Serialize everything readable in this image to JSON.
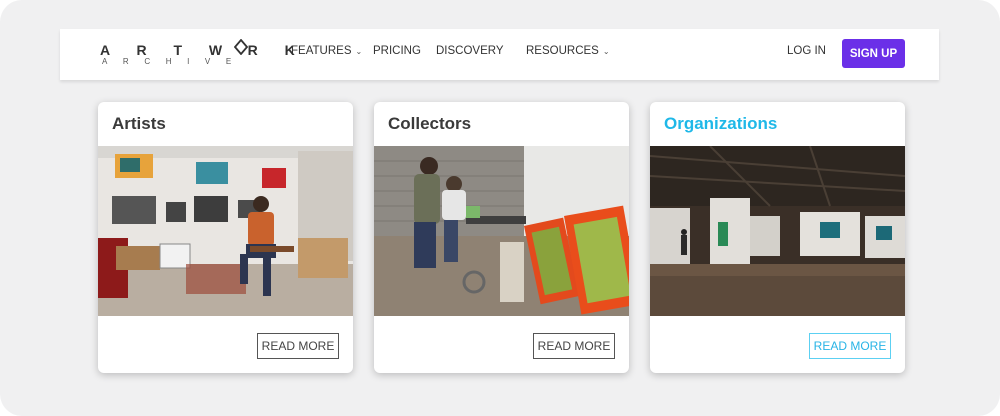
{
  "brand": {
    "top": "ARTWORK",
    "bottom": "ARCHIVE"
  },
  "nav": {
    "features": "FEATURES",
    "pricing": "PRICING",
    "discovery": "DISCOVERY",
    "resources": "RESOURCES",
    "login": "LOG IN",
    "signup": "SIGN UP"
  },
  "cards": [
    {
      "title": "Artists",
      "button": "READ MORE"
    },
    {
      "title": "Collectors",
      "button": "READ MORE"
    },
    {
      "title": "Organizations",
      "button": "READ MORE"
    }
  ],
  "colors": {
    "accent": "#1fb8e8",
    "signup": "#6b2fe8"
  }
}
